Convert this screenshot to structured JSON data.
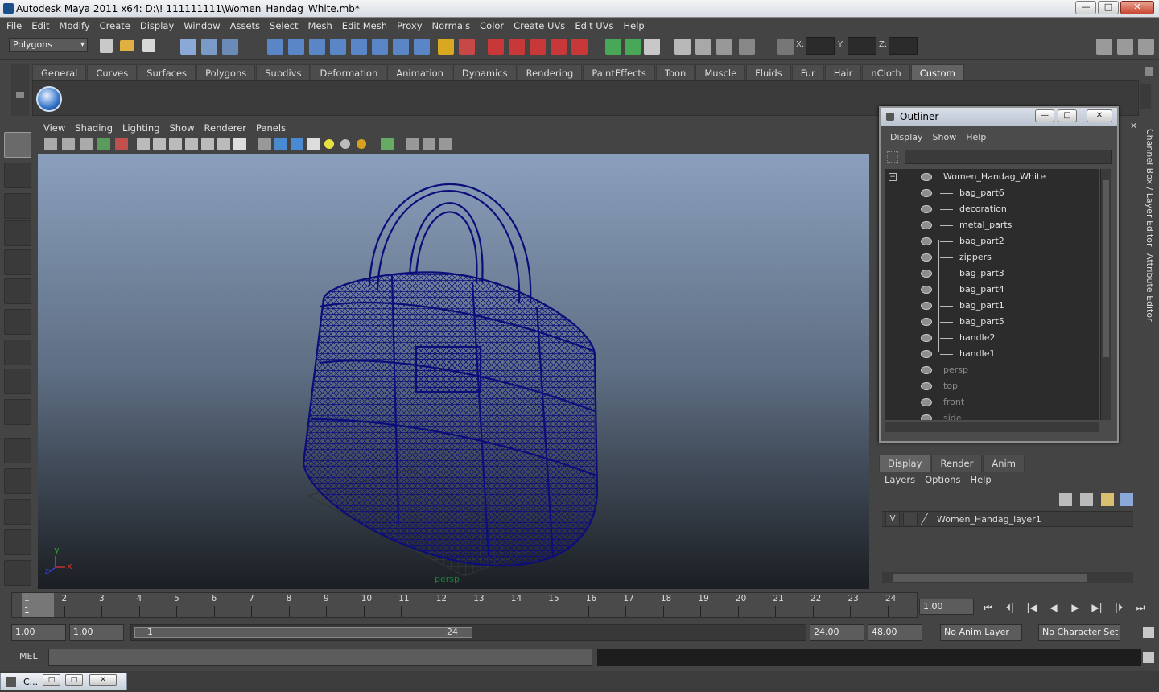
{
  "window": {
    "title": "Autodesk Maya 2011 x64: D:\\! 111111111\\Women_Handag_White.mb*",
    "min": "—",
    "max": "□",
    "close": "✕"
  },
  "menubar": [
    "File",
    "Edit",
    "Modify",
    "Create",
    "Display",
    "Window",
    "Assets",
    "Select",
    "Mesh",
    "Edit Mesh",
    "Proxy",
    "Normals",
    "Color",
    "Create UVs",
    "Edit UVs",
    "Help"
  ],
  "statusline": {
    "mode": "Polygons",
    "x_label": "X:",
    "y_label": "Y:",
    "z_label": "Z:"
  },
  "shelf_tabs": [
    "General",
    "Curves",
    "Surfaces",
    "Polygons",
    "Subdivs",
    "Deformation",
    "Animation",
    "Dynamics",
    "Rendering",
    "PaintEffects",
    "Toon",
    "Muscle",
    "Fluids",
    "Fur",
    "Hair",
    "nCloth",
    "Custom"
  ],
  "active_shelf": "Custom",
  "viewport": {
    "menu": [
      "View",
      "Shading",
      "Lighting",
      "Show",
      "Renderer",
      "Panels"
    ],
    "camera_label": "persp",
    "axis_y": "y",
    "axis_x": "x",
    "axis_z": "z",
    "wire_color": "#0d0d7a"
  },
  "outliner": {
    "title": "Outliner",
    "menu": [
      "Display",
      "Show",
      "Help"
    ],
    "root": "Women_Handag_White",
    "children": [
      "bag_part6",
      "decoration",
      "metal_parts",
      "bag_part2",
      "zippers",
      "bag_part3",
      "bag_part4",
      "bag_part1",
      "bag_part5",
      "handle2",
      "handle1"
    ],
    "cameras": [
      "persp",
      "top",
      "front",
      "side"
    ],
    "collapse_glyph": "−"
  },
  "side_tabs": [
    "Channel Box / Layer Editor",
    "Attribute Editor"
  ],
  "layer_editor": {
    "tabs": [
      "Display",
      "Render",
      "Anim"
    ],
    "menu": [
      "Layers",
      "Options",
      "Help"
    ],
    "layers": [
      {
        "visible": "V",
        "name": "Women_Handag_layer1"
      }
    ]
  },
  "timeline": {
    "ticks": [
      "1",
      "2",
      "3",
      "4",
      "5",
      "6",
      "7",
      "8",
      "9",
      "10",
      "11",
      "12",
      "13",
      "14",
      "15",
      "16",
      "17",
      "18",
      "19",
      "20",
      "21",
      "22",
      "23",
      "24"
    ],
    "current_frame_marker": "1",
    "current_time": "1.00"
  },
  "playback": [
    "⏮",
    "⏴|",
    "|◀",
    "◀",
    "▶",
    "▶|",
    "|⏵",
    "⏭"
  ],
  "range": {
    "start": "1.00",
    "anim_start": "1.00",
    "range_start": "1",
    "range_end": "24",
    "playback_end": "24.00",
    "anim_end": "48.00",
    "anim_layer": "No Anim Layer",
    "char_set": "No Character Set"
  },
  "command": {
    "label": "MEL"
  },
  "minimized_window": {
    "title": "C..."
  }
}
